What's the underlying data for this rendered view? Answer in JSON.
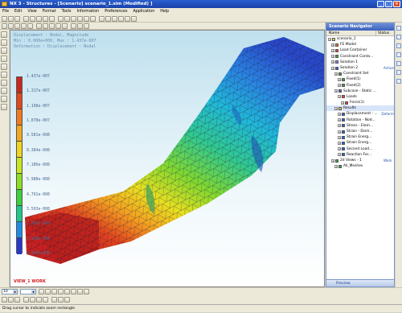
{
  "window": {
    "title": "NX 3 - Structures - [Scenario] scenario_1.sim (Modified) ]"
  },
  "menu": [
    "File",
    "Edit",
    "View",
    "Format",
    "Tools",
    "Information",
    "Preferences",
    "Application",
    "Help"
  ],
  "viewport": {
    "header_lines": [
      "Displacement - Nodal, Magnitude",
      "Min : 0.000e+000, Max : 1.437e-007",
      "Deformation : Displacement - Nodal"
    ],
    "legend_labels": [
      "1.437e-007",
      "1.317e-007",
      "1.198e-007",
      "1.078e-007",
      "9.581e-008",
      "8.384e-008",
      "7.186e-008",
      "5.988e-008",
      "4.791e-008",
      "3.593e-008",
      "2.395e-008",
      "1.198e-008",
      "0.000e+000"
    ],
    "view_label": "VIEW_1 WORK",
    "legend_colors": [
      "#c8281e",
      "#e0481e",
      "#f07a1e",
      "#f4a81e",
      "#f0d41e",
      "#c8e61e",
      "#8ce01e",
      "#3cd03c",
      "#1ec88c",
      "#1eb4d0",
      "#1e8ce6",
      "#2860e0",
      "#2838c8"
    ]
  },
  "navigator": {
    "title": "Scenario Navigator",
    "col_name": "Name",
    "col_status": "Status",
    "items": [
      {
        "label": "scenario_1",
        "status": "",
        "indent": 0,
        "color": "#f4d040"
      },
      {
        "label": "FE Model",
        "status": "",
        "indent": 1,
        "color": "#e07020"
      },
      {
        "label": "Load Container",
        "status": "",
        "indent": 1,
        "color": "#e04040"
      },
      {
        "label": "Constraint Conta...",
        "status": "",
        "indent": 1,
        "color": "#40a040"
      },
      {
        "label": "Solution 1",
        "status": "",
        "indent": 1,
        "color": "#8080ff"
      },
      {
        "label": "Solution 2",
        "status": "Active",
        "indent": 1,
        "color": "#4060e0"
      },
      {
        "label": "Constraint Set",
        "status": "",
        "indent": 2,
        "color": "#40a040"
      },
      {
        "label": "Fixed(1)",
        "status": "",
        "indent": 3,
        "color": "#40a040"
      },
      {
        "label": "Fixed(2)",
        "status": "",
        "indent": 3,
        "color": "#40a040"
      },
      {
        "label": "Subcase - Static ...",
        "status": "",
        "indent": 2,
        "color": "#4060e0"
      },
      {
        "label": "Loads",
        "status": "",
        "indent": 3,
        "color": "#e04040"
      },
      {
        "label": "Force(1)",
        "status": "",
        "indent": 4,
        "color": "#e04040"
      },
      {
        "label": "Results",
        "status": "",
        "indent": 2,
        "color": "#f4d040"
      },
      {
        "label": "Displacement - ...",
        "status": "Deform",
        "indent": 3,
        "color": "#2060e0"
      },
      {
        "label": "Rotation - Nod...",
        "status": "",
        "indent": 3,
        "color": "#2060e0"
      },
      {
        "label": "Stress - Elem...",
        "status": "",
        "indent": 3,
        "color": "#2060e0"
      },
      {
        "label": "Strain - Elem...",
        "status": "",
        "indent": 3,
        "color": "#2060e0"
      },
      {
        "label": "Strain Energ...",
        "status": "",
        "indent": 3,
        "color": "#2060e0"
      },
      {
        "label": "Strain Energ...",
        "status": "",
        "indent": 3,
        "color": "#2060e0"
      },
      {
        "label": "Second Load...",
        "status": "",
        "indent": 3,
        "color": "#2060e0"
      },
      {
        "label": "Reaction For...",
        "status": "",
        "indent": 3,
        "color": "#2060e0"
      },
      {
        "label": "2d Views - 1",
        "status": "Work",
        "indent": 1,
        "color": "#40a040"
      },
      {
        "label": "All_Meshes",
        "status": "",
        "indent": 2,
        "color": "#40a040"
      }
    ],
    "preview_label": "Preview"
  },
  "bottom": {
    "select1": "10",
    "select2": ""
  },
  "status_bar": "Drag cursor to indicate zoom rectangle"
}
